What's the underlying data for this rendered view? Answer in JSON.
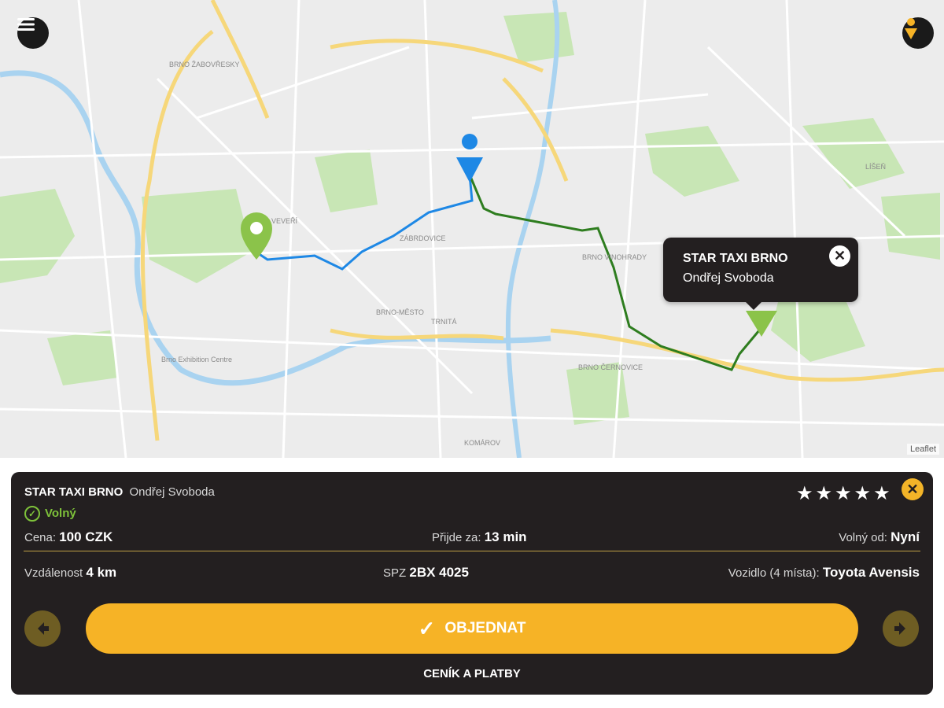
{
  "map": {
    "attribution": "Leaflet",
    "labels": [
      "BRNO ŽABOVŘESKY",
      "Brno Exhibition Centre",
      "BRNO-MĚSTO",
      "ZÁBRDOVICE",
      "BRNO ČERNOVICE",
      "BRNO VINOHRADY",
      "LÍŠEŇ",
      "TRNITÁ",
      "VEVEŘÍ",
      "KOMÁROV"
    ],
    "route_color_1": "#1e88e5",
    "route_color_2": "#2e7d1f"
  },
  "menu_icon": "hamburger-menu-icon",
  "user_icon": "person-pin-icon",
  "popup": {
    "company": "STAR TAXI BRNO",
    "driver": "Ondřej Svoboda",
    "close_icon": "close-icon"
  },
  "panel": {
    "company": "STAR TAXI BRNO",
    "driver": "Ondřej Svoboda",
    "rating_stars": 5,
    "stars_text": "★★★★★",
    "status_icon": "check-circle-icon",
    "status": "Volný",
    "price_label": "Cena:",
    "price_value": "100 CZK",
    "arrives_label": "Přijde za:",
    "arrives_value": "13 min",
    "free_from_label": "Volný od:",
    "free_from_value": "Nyní",
    "distance_label": "Vzdálenost",
    "distance_value": "4 km",
    "plate_label": "SPZ",
    "plate_value": "2BX 4025",
    "vehicle_label": "Vozidlo (4 místa):",
    "vehicle_value": "Toyota Avensis",
    "order_button": "OBJEDNAT",
    "pricing_link": "CENÍK A PLATBY",
    "accent_color": "#f6b326",
    "status_color": "#7ec23a"
  }
}
